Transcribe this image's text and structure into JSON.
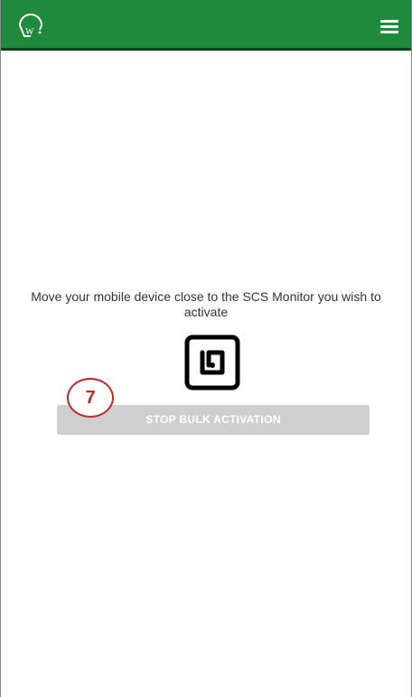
{
  "app": {
    "logo_icon": "wifi-w-logo-icon",
    "accent_color": "#1e8a3c",
    "menu_icon": "hamburger-menu-icon"
  },
  "main": {
    "instruction_text": "Move your mobile device close to the SCS Monitor you wish to activate",
    "nfc_icon": "nfc-icon",
    "callout_number": "7",
    "stop_button_label": "STOP BULK ACTIVATION"
  }
}
